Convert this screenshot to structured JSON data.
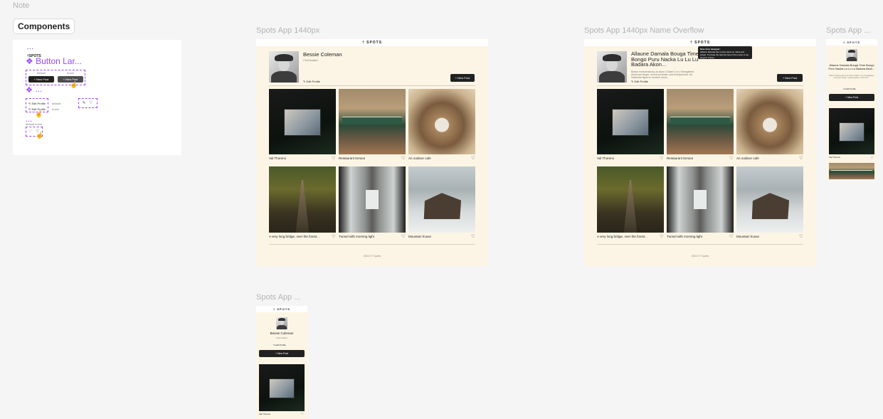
{
  "canvas": {
    "note_label": "Note",
    "components_label": "Components",
    "frame_labels": {
      "desktop": "Spots App 1440px",
      "overflow": "Spots App 1440px Name Overflow",
      "mobile_right": "Spots App ...",
      "mobile_bottom": "Spots App ..."
    }
  },
  "components": {
    "dots": "...",
    "spots_text": "†SPOTS",
    "button_large_label": "Button Lar...",
    "state_default": "default",
    "state_hover": "hover",
    "new_post_btn": "+ New Post",
    "edit_profile_a": "✎ Edit Profile",
    "edit_profile_b": "✎ Edit Profile",
    "edit_default": "default",
    "edit_hover": "hover",
    "like_label": "default  hover"
  },
  "app": {
    "logo": "† SPOTS",
    "profile": {
      "name": "Bessie Coleman",
      "job": "Civil Aviator",
      "edit_label": "✎ Edit Profile",
      "new_post_label": "+ New Post"
    },
    "overflow_profile": {
      "name": "Allaune Damala Bouga Time Bongo Puru Nacka Lu Lu Lu Badara Akon...",
      "job": "Brawn motorsmacosy ac Akon (\"Adam\") is a Senegalese-American singer, record producer, and entrepreneur. An influential figure in modern world...",
      "tooltip_title": "Note from designer:",
      "tooltip_body": "Allaune Damala has a long name so name text wraps. Truncate the last two lines if the name is too long for 2 lines."
    },
    "mobile_overflow_name": "Allaune Damala Bouga Time Bongo Puru Nacka Lu Lu Lu Badara Akon...",
    "mobile_overflow_job": "Brawn motorsmacosy ac Akon (\"Adam\") is a Senegalese-American singer, record producer, and entre...",
    "cards": [
      {
        "title": "Val Thorens",
        "image": "valthorens"
      },
      {
        "title": "Restaurant terrace",
        "image": "restaurant"
      },
      {
        "title": "An outdoor cafe",
        "image": "cafe"
      },
      {
        "title": "A very long bridge, over the forest...",
        "image": "bridge"
      },
      {
        "title": "Tunnel with morning light",
        "image": "tunnel"
      },
      {
        "title": "Mountain house",
        "image": "mountain"
      }
    ],
    "heart_icon": "♡",
    "footer": "2024 © Spots"
  },
  "colors": {
    "accent": "#9747ff",
    "page_bg": "#fcf5e5",
    "canvas_bg": "#f5f5f5",
    "button_dark": "#212121"
  }
}
